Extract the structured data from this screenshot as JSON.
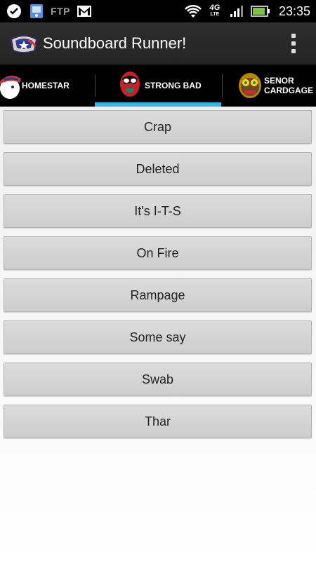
{
  "status_bar": {
    "ftp_label": "FTP",
    "network_label": "4G",
    "network_sub": "LTE",
    "time": "23:35",
    "icons": [
      "checkmark-bubble-icon",
      "app-icon",
      "ftp-icon",
      "gmail-icon",
      "wifi-icon",
      "4g-lte-icon",
      "signal-icon",
      "battery-icon"
    ]
  },
  "action_bar": {
    "title": "Soundboard Runner!",
    "overflow_icon": "overflow-menu-icon"
  },
  "tabs": [
    {
      "label": "HOMESTAR",
      "selected": false
    },
    {
      "label": "STRONG BAD",
      "selected": true
    },
    {
      "label": "SENOR\nCARDGAGE",
      "selected": false
    }
  ],
  "buttons": [
    "Crap",
    "Deleted",
    "It's I-T-S",
    "On Fire",
    "Rampage",
    "Some say",
    "Swab",
    "Thar"
  ],
  "colors": {
    "tab_indicator": "#33b5e5",
    "button_bg": "#d4d4d4"
  }
}
